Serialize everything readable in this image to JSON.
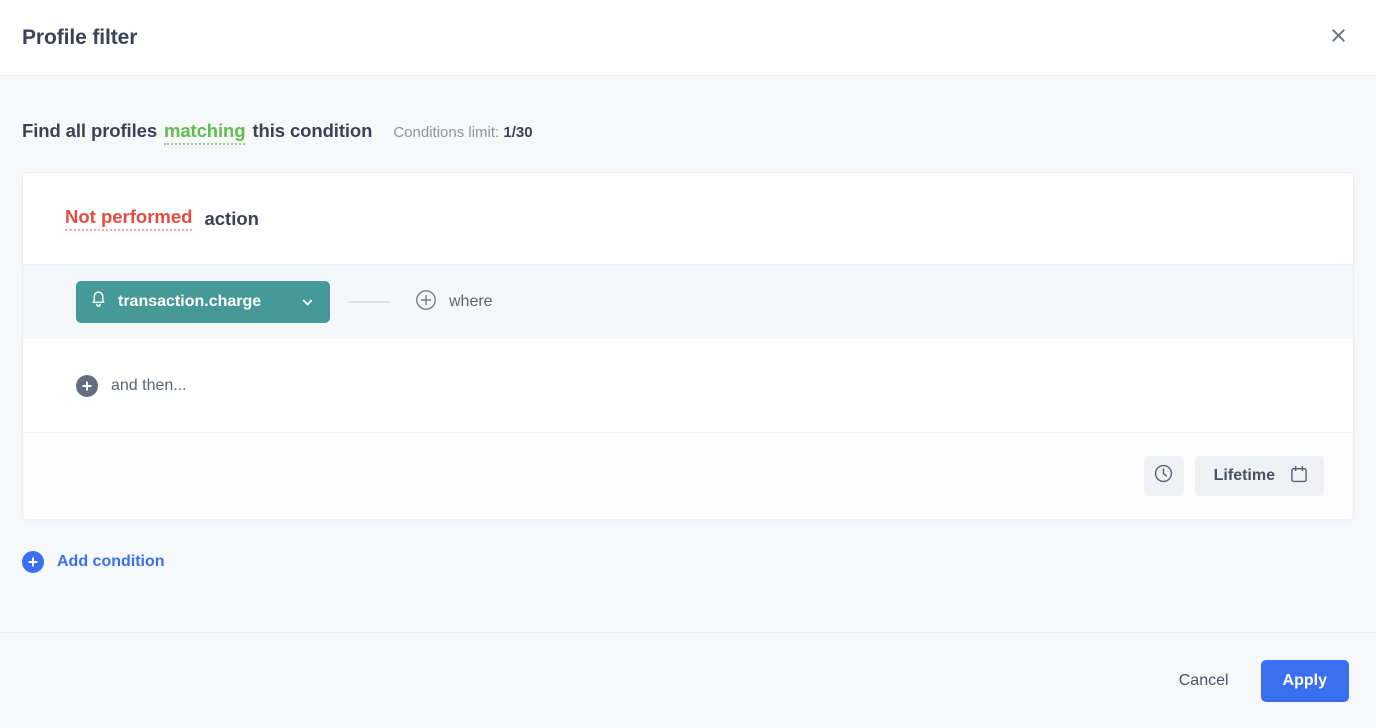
{
  "header": {
    "title": "Profile filter",
    "close_icon": "close-icon"
  },
  "body": {
    "find_prefix": "Find all profiles",
    "find_highlight": "matching",
    "find_suffix": "this condition",
    "conditions_limit_label": "Conditions limit:",
    "conditions_limit_value": "1/30"
  },
  "condition_card": {
    "performed_state": "Not performed",
    "action_word": "action",
    "event": {
      "icon": "bell-icon",
      "label": "transaction.charge",
      "chevron": "chevron-down-icon"
    },
    "where_label": "where",
    "where_icon": "plus-circle-outline-icon",
    "and_then_label": "and then...",
    "and_then_icon": "plus-circle-icon",
    "time_icon": "clock-icon",
    "timeframe_label": "Lifetime",
    "timeframe_icon": "calendar-icon"
  },
  "add_condition": {
    "label": "Add condition",
    "icon": "plus-circle-icon"
  },
  "footer": {
    "cancel_label": "Cancel",
    "apply_label": "Apply"
  },
  "colors": {
    "accent_blue": "#3b6ff2",
    "event_teal": "#459a99",
    "matching_green": "#61bd4f",
    "not_performed_red": "#e64b40",
    "page_background": "#f7f8fa"
  }
}
